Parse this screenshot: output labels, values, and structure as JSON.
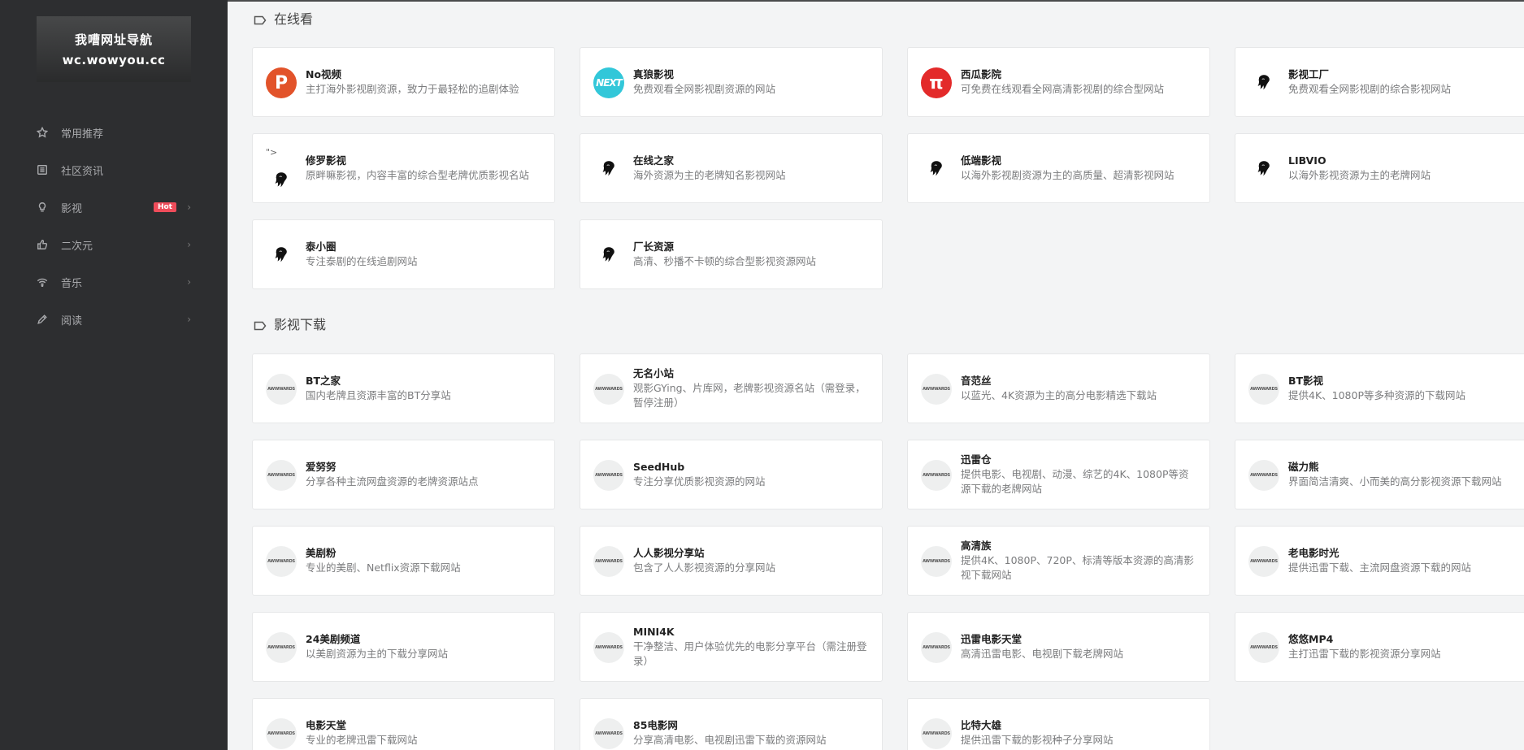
{
  "sidebar": {
    "logo_line1": "我嘈网址导航",
    "logo_line2": "wc.wowyou.cc",
    "items": [
      {
        "label": "常用推荐",
        "icon": "star-icon"
      },
      {
        "label": "社区资讯",
        "icon": "newspaper-icon"
      },
      {
        "label": "影视",
        "icon": "lightbulb-icon",
        "badge": "Hot"
      },
      {
        "label": "二次元",
        "icon": "thumbs-up-icon"
      },
      {
        "label": "音乐",
        "icon": "wifi-icon"
      },
      {
        "label": "阅读",
        "icon": "pencil-icon"
      }
    ]
  },
  "sections": [
    {
      "title": "在线看",
      "cards": [
        {
          "name": "No视频",
          "desc": "主打海外影视剧资源，致力于最轻松的追剧体验",
          "icon": "p-logo-icon"
        },
        {
          "name": "真狼影视",
          "desc": "免费观看全网影视剧资源的网站",
          "icon": "next-logo-icon"
        },
        {
          "name": "西瓜影院",
          "desc": "可免费在线观看全网高清影视剧的综合型网站",
          "icon": "pi-logo-icon"
        },
        {
          "name": "影视工厂",
          "desc": "免费观看全网影视剧的综合影视网站",
          "icon": "jellyfish-icon"
        },
        {
          "name": "修罗影视",
          "desc": "原畔嘛影视，内容丰富的综合型老牌优质影视名站",
          "icon": "jellyfish-icon",
          "broken": "\">"
        },
        {
          "name": "在线之家",
          "desc": "海外资源为主的老牌知名影视网站",
          "icon": "jellyfish-icon"
        },
        {
          "name": "低端影视",
          "desc": "以海外影视剧资源为主的高质量、超清影视网站",
          "icon": "jellyfish-icon"
        },
        {
          "name": "LIBVIO",
          "desc": "以海外影视资源为主的老牌网站",
          "icon": "jellyfish-icon"
        },
        {
          "name": "泰小圈",
          "desc": "专注泰剧的在线追剧网站",
          "icon": "jellyfish-icon"
        },
        {
          "name": "厂长资源",
          "desc": "高清、秒播不卡顿的综合型影视资源网站",
          "icon": "jellyfish-icon"
        }
      ]
    },
    {
      "title": "影视下载",
      "cards": [
        {
          "name": "BT之家",
          "desc": "国内老牌且资源丰富的BT分享站",
          "icon": "awwwards-icon"
        },
        {
          "name": "无名小站",
          "desc": "观影GYing、片库网，老牌影视资源名站（需登录，暂停注册）",
          "icon": "awwwards-icon"
        },
        {
          "name": "音范丝",
          "desc": "以蓝光、4K资源为主的高分电影精选下载站",
          "icon": "awwwards-icon"
        },
        {
          "name": "BT影视",
          "desc": "提供4K、1080P等多种资源的下载网站",
          "icon": "awwwards-icon"
        },
        {
          "name": "爱努努",
          "desc": "分享各种主流网盘资源的老牌资源站点",
          "icon": "awwwards-icon"
        },
        {
          "name": "SeedHub",
          "desc": "专注分享优质影视资源的网站",
          "icon": "awwwards-icon"
        },
        {
          "name": "迅雷仓",
          "desc": "提供电影、电视剧、动漫、综艺的4K、1080P等资源下载的老牌网站",
          "icon": "awwwards-icon"
        },
        {
          "name": "磁力熊",
          "desc": "界面简洁清爽、小而美的高分影视资源下载网站",
          "icon": "awwwards-icon"
        },
        {
          "name": "美剧粉",
          "desc": "专业的美剧、Netflix资源下载网站",
          "icon": "awwwards-icon"
        },
        {
          "name": "人人影视分享站",
          "desc": "包含了人人影视资源的分享网站",
          "icon": "awwwards-icon"
        },
        {
          "name": "高清族",
          "desc": "提供4K、1080P、720P、标清等版本资源的高清影视下载网站",
          "icon": "awwwards-icon"
        },
        {
          "name": "老电影时光",
          "desc": "提供迅雷下载、主流网盘资源下载的网站",
          "icon": "awwwards-icon"
        },
        {
          "name": "24美剧频道",
          "desc": "以美剧资源为主的下载分享网站",
          "icon": "awwwards-icon"
        },
        {
          "name": "MINI4K",
          "desc": "干净整洁、用户体验优先的电影分享平台（需注册登录）",
          "icon": "awwwards-icon"
        },
        {
          "name": "迅雷电影天堂",
          "desc": "高清迅雷电影、电视剧下载老牌网站",
          "icon": "awwwards-icon"
        },
        {
          "name": "悠悠MP4",
          "desc": "主打迅雷下载的影视资源分享网站",
          "icon": "awwwards-icon"
        },
        {
          "name": "电影天堂",
          "desc": "专业的老牌迅雷下载网站",
          "icon": "awwwards-icon"
        },
        {
          "name": "85电影网",
          "desc": "分享高清电影、电视剧迅雷下载的资源网站",
          "icon": "awwwards-icon"
        },
        {
          "name": "比特大雄",
          "desc": "提供迅雷下载的影视种子分享网站",
          "icon": "awwwards-icon"
        }
      ]
    }
  ],
  "awwwards_text": "AWWWARDS",
  "colors": {
    "sidebar_bg": "#2d2e30",
    "hot_badge": "#ef4c5a",
    "page_bg": "#f3f4f5"
  }
}
